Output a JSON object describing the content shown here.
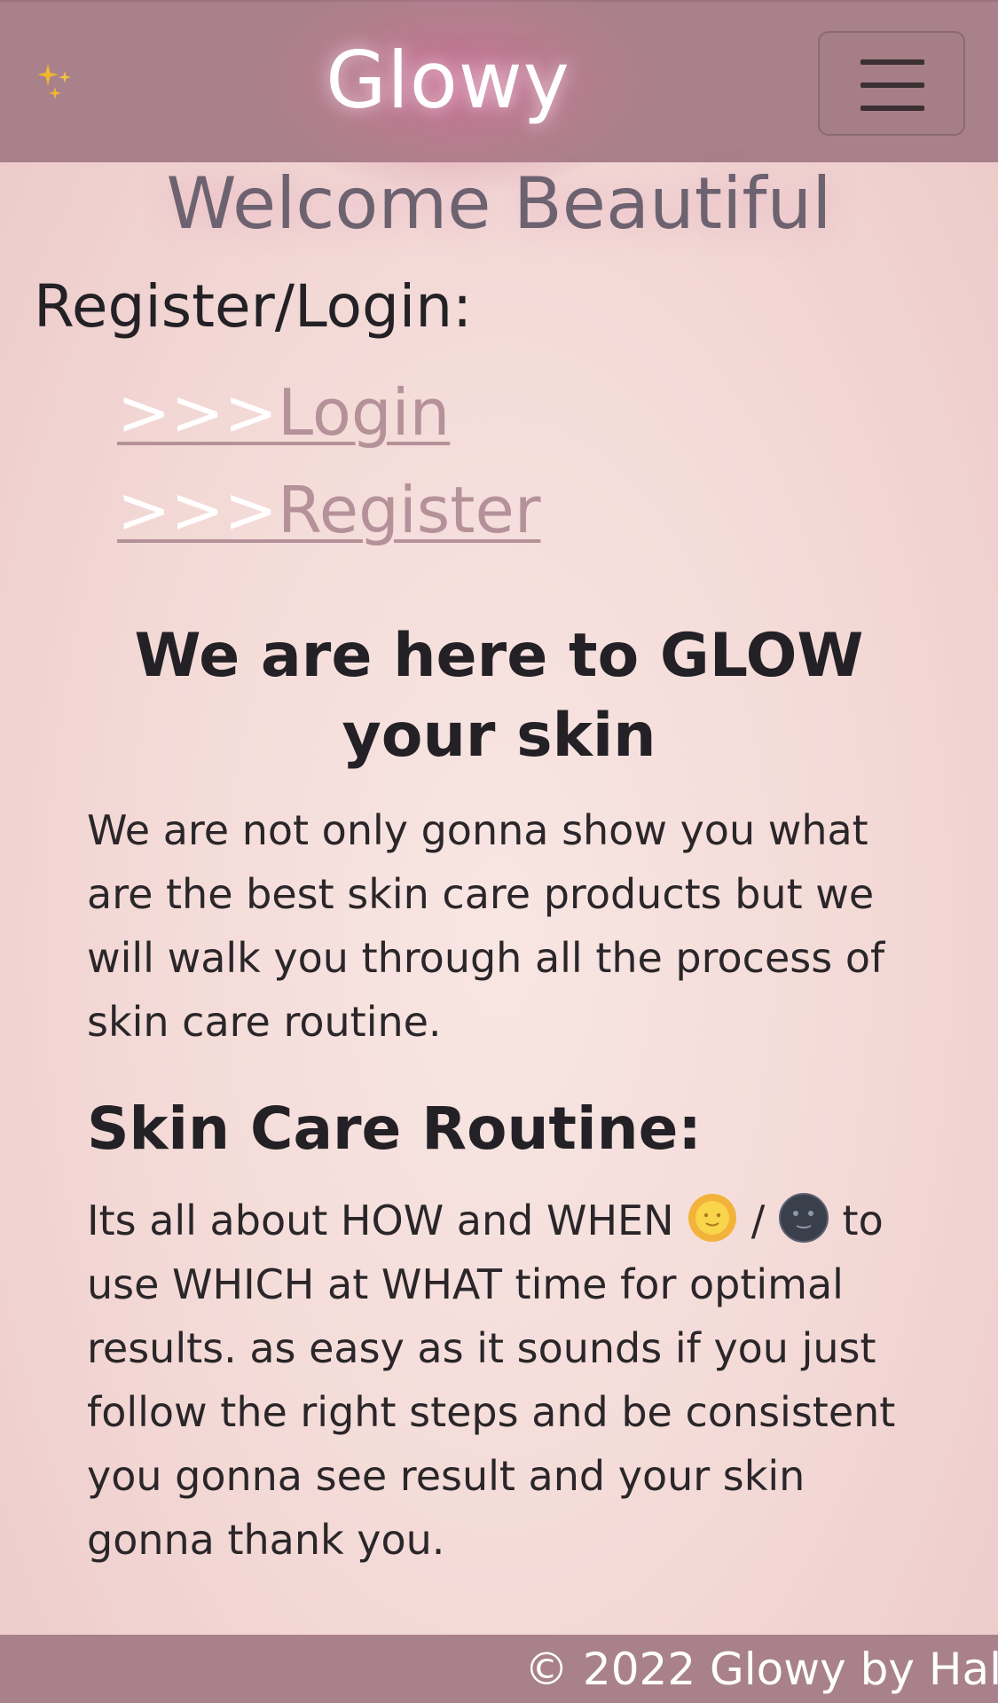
{
  "navbar": {
    "brand": "Glowy",
    "logo_icon": "sparkles-icon",
    "menu_icon": "hamburger-menu-icon"
  },
  "welcome": "Welcome Beautiful",
  "register_section": {
    "heading": "Register/Login:",
    "links": [
      {
        "arrows": ">>>",
        "label": "Login"
      },
      {
        "arrows": ">>>",
        "label": "Register"
      }
    ]
  },
  "intro": {
    "heading": "We are here to GLOW your skin",
    "text": "We are not only gonna show you what are the best skin care products but we will walk you through all the process of skin care routine."
  },
  "routine": {
    "heading": "Skin Care Routine:",
    "text_before": "Its all about HOW and WHEN ",
    "sun_icon": "sun-face-icon",
    "separator": " / ",
    "moon_icon": "new-moon-face-icon",
    "text_after": " to use WHICH at WHAT time for optimal results. as easy as it sounds if you just follow the right steps and be consistent you gonna see result and your skin gonna thank you."
  },
  "footer": {
    "text": "© 2022 Glowy by Hal"
  },
  "colors": {
    "navbar": "#a9818a",
    "link": "#b59199",
    "welcome": "#6d6270",
    "background": "#f3d9d6"
  }
}
